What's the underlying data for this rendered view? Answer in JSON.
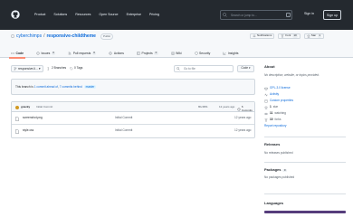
{
  "header": {
    "nav": [
      "Product",
      "Solutions",
      "Resources",
      "Open Source",
      "Enterprise",
      "Pricing"
    ],
    "search_placeholder": "Search or jump to...",
    "search_kbd": "/",
    "signin": "Sign in",
    "signup": "Sign up"
  },
  "repo": {
    "owner": "cyberchimps",
    "name": "responsive-childtheme",
    "visibility": "Public",
    "notifications": "Notifications",
    "fork_label": "Fork",
    "fork_count": "10",
    "star_label": "Star",
    "star_count": "1"
  },
  "tabs": [
    {
      "label": "Code",
      "icon": "code-icon"
    },
    {
      "label": "Issues",
      "count": "0",
      "icon": "issue-icon"
    },
    {
      "label": "Pull requests",
      "count": "0",
      "icon": "pull-request-icon"
    },
    {
      "label": "Actions",
      "icon": "play-icon"
    },
    {
      "label": "Projects",
      "count": "0",
      "icon": "table-icon"
    },
    {
      "label": "Wiki",
      "icon": "book-icon"
    },
    {
      "label": "Security",
      "icon": "shield-icon"
    },
    {
      "label": "Insights",
      "icon": "graph-icon"
    }
  ],
  "filenav": {
    "branch": "responsive-li...",
    "branches": "2 Branches",
    "tags": "0 Tags",
    "goto_placeholder": "Go to file",
    "code_label": "Code"
  },
  "flash": {
    "prefix": "This branch is",
    "ahead": "1 commit ahead of",
    "behind": "7 commits behind",
    "base": "master"
  },
  "commit": {
    "user": "gnazky",
    "message": "Initial Commit",
    "sha": "8bc9f61",
    "age": "12 years ago",
    "history": "6 Commits"
  },
  "files": [
    {
      "name": "screenshot.png",
      "message": "Initial Commit",
      "age": "12 years ago"
    },
    {
      "name": "style.css",
      "message": "Initial Commit",
      "age": "12 years ago"
    }
  ],
  "sidebar": {
    "about": "About",
    "description": "No description, website, or topics provided.",
    "items": [
      {
        "label": "GPL-3.0 license",
        "icon": "law-icon"
      },
      {
        "label": "Activity",
        "icon": "pulse-icon"
      },
      {
        "label": "Custom properties",
        "icon": "note-icon"
      },
      {
        "count": "1",
        "label": "star",
        "icon": "star-icon"
      },
      {
        "count": "11",
        "label": "watching",
        "icon": "eye-icon"
      },
      {
        "count": "10",
        "label": "forks",
        "icon": "fork-icon"
      }
    ],
    "report": "Report repository",
    "releases_title": "Releases",
    "releases_text": "No releases published",
    "packages_title": "Packages",
    "packages_count": "0",
    "packages_text": "No packages published",
    "languages_title": "Languages"
  },
  "colors": {
    "header_bg": "#24292f",
    "link": "#0969da",
    "tab_underline": "#fd8c73",
    "language_css": "#563d7c"
  }
}
